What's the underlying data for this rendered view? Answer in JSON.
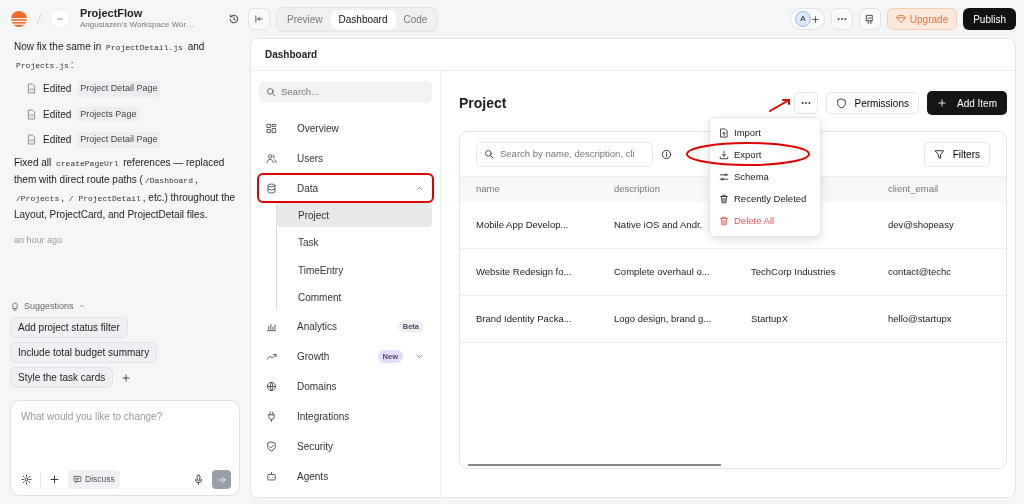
{
  "project": {
    "name": "ProjectFlow",
    "workspace": "Angusiazen's Workspace Wor…"
  },
  "chat": {
    "messages": [
      {
        "kind": "text",
        "segments": [
          {
            "text": "Now fix the same in "
          },
          {
            "text": "ProjectDetail.js",
            "code": true
          },
          {
            "text": " and "
          },
          {
            "text": "Projects.js",
            "code": true
          },
          {
            "text": ":"
          }
        ]
      },
      {
        "kind": "edit",
        "action": "Edited",
        "file": "Project Detail Page"
      },
      {
        "kind": "edit",
        "action": "Edited",
        "file": "Projects Page"
      },
      {
        "kind": "edit",
        "action": "Edited",
        "file": "Project Detail Page"
      },
      {
        "kind": "text",
        "segments": [
          {
            "text": "Fixed all "
          },
          {
            "text": "createPageUrl",
            "code": true
          },
          {
            "text": " references — replaced them with direct route paths ("
          },
          {
            "text": "/Dashboard",
            "code": true
          },
          {
            "text": ", "
          },
          {
            "text": "/Projects",
            "code": true
          },
          {
            "text": ", "
          },
          {
            "text": "/ ProjectDetail",
            "code": true
          },
          {
            "text": ", etc.) throughout the Layout, ProjectCard, and ProjectDetail files."
          }
        ]
      }
    ],
    "time": "an hour ago"
  },
  "suggestions": {
    "label": "Suggestions",
    "expanded": true,
    "items": [
      "Add project status filter",
      "Include total budget summary",
      "Style the task cards"
    ]
  },
  "composer": {
    "placeholder": "What would you like to change?",
    "mode_button": "Discuss"
  },
  "view_tabs": [
    {
      "label": "Preview",
      "selected": false
    },
    {
      "label": "Dashboard",
      "selected": true
    },
    {
      "label": "Code",
      "selected": false
    }
  ],
  "avatar": {
    "initial": "A"
  },
  "header_buttons": {
    "upgrade": "Upgrade",
    "publish": "Publish"
  },
  "dashboard": {
    "title": "Dashboard",
    "search_placeholder": "Search...",
    "nav": [
      {
        "label": "Overview",
        "selected": false
      },
      {
        "label": "Users",
        "selected": false
      },
      {
        "label": "Data",
        "selected": false,
        "expanded": true,
        "highlighted": true,
        "children": [
          {
            "label": "Project",
            "selected": true
          },
          {
            "label": "Task",
            "selected": false
          },
          {
            "label": "TimeEntry",
            "selected": false
          },
          {
            "label": "Comment",
            "selected": false
          }
        ]
      },
      {
        "label": "Analytics",
        "selected": false,
        "badge": {
          "text": "Beta",
          "color": "#f0f0f0"
        }
      },
      {
        "label": "Growth",
        "selected": false,
        "badge": {
          "text": "New",
          "color": "#e5dcfb"
        },
        "expanded": false
      },
      {
        "label": "Domains",
        "selected": false
      },
      {
        "label": "Integrations",
        "selected": false
      },
      {
        "label": "Security",
        "selected": false
      },
      {
        "label": "Agents",
        "selected": false
      }
    ]
  },
  "page": {
    "title": "Project",
    "more_annotated": true,
    "permissions": "Permissions",
    "add": "Add Item",
    "menu": {
      "open": true,
      "items": [
        {
          "label": "Import",
          "kind": "normal",
          "highlighted": false
        },
        {
          "label": "Export",
          "kind": "normal",
          "highlighted": true
        },
        {
          "label": "Schema",
          "kind": "normal",
          "highlighted": false
        },
        {
          "label": "Recently Deleted",
          "kind": "normal",
          "highlighted": false
        },
        {
          "label": "Delete All",
          "kind": "danger",
          "highlighted": false
        }
      ]
    },
    "table": {
      "search_placeholder": "Search by name, description, cli",
      "filters": "Filters",
      "columns": [
        "name",
        "description",
        null,
        "client_email"
      ],
      "rows": [
        [
          "Mobile App Develop...",
          "Native iOS and Andr.",
          null,
          "dev@shopeasy"
        ],
        [
          "Website Redesign fo...",
          "Complete overhaul o...",
          "TechCorp Industries",
          "contact@techc"
        ],
        [
          "Brand Identity Packa...",
          "Logo design, brand g...",
          "StartupX",
          "hello@startupx"
        ]
      ]
    }
  }
}
